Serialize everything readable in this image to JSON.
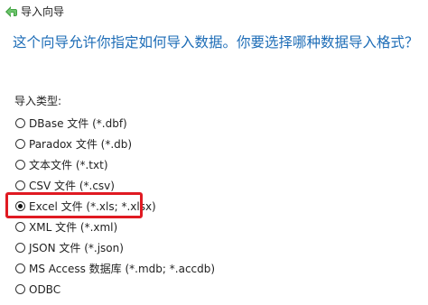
{
  "header": {
    "back_icon": "green-back-arrow-icon",
    "title": "导入向导"
  },
  "instruction": "这个向导允许你指定如何导入数据。你要选择哪种数据导入格式？",
  "import_type": {
    "label": "导入类型:",
    "selected": "Excel 文件 (*.xls; *.xlsx)",
    "options": [
      {
        "label": "DBase 文件 (*.dbf)",
        "checked": false
      },
      {
        "label": "Paradox 文件 (*.db)",
        "checked": false
      },
      {
        "label": "文本文件 (*.txt)",
        "checked": false
      },
      {
        "label": "CSV 文件 (*.csv)",
        "checked": false
      },
      {
        "label": "Excel 文件 (*.xls; *.xlsx)",
        "checked": true
      },
      {
        "label": "XML 文件 (*.xml)",
        "checked": false
      },
      {
        "label": "JSON 文件 (*.json)",
        "checked": false
      },
      {
        "label": "MS Access 数据库 (*.mdb; *.accdb)",
        "checked": false
      },
      {
        "label": "ODBC",
        "checked": false
      }
    ]
  },
  "colors": {
    "instruction_text": "#1e6db7",
    "highlight_border": "#e01a22",
    "back_arrow": "#3a9a3a"
  }
}
